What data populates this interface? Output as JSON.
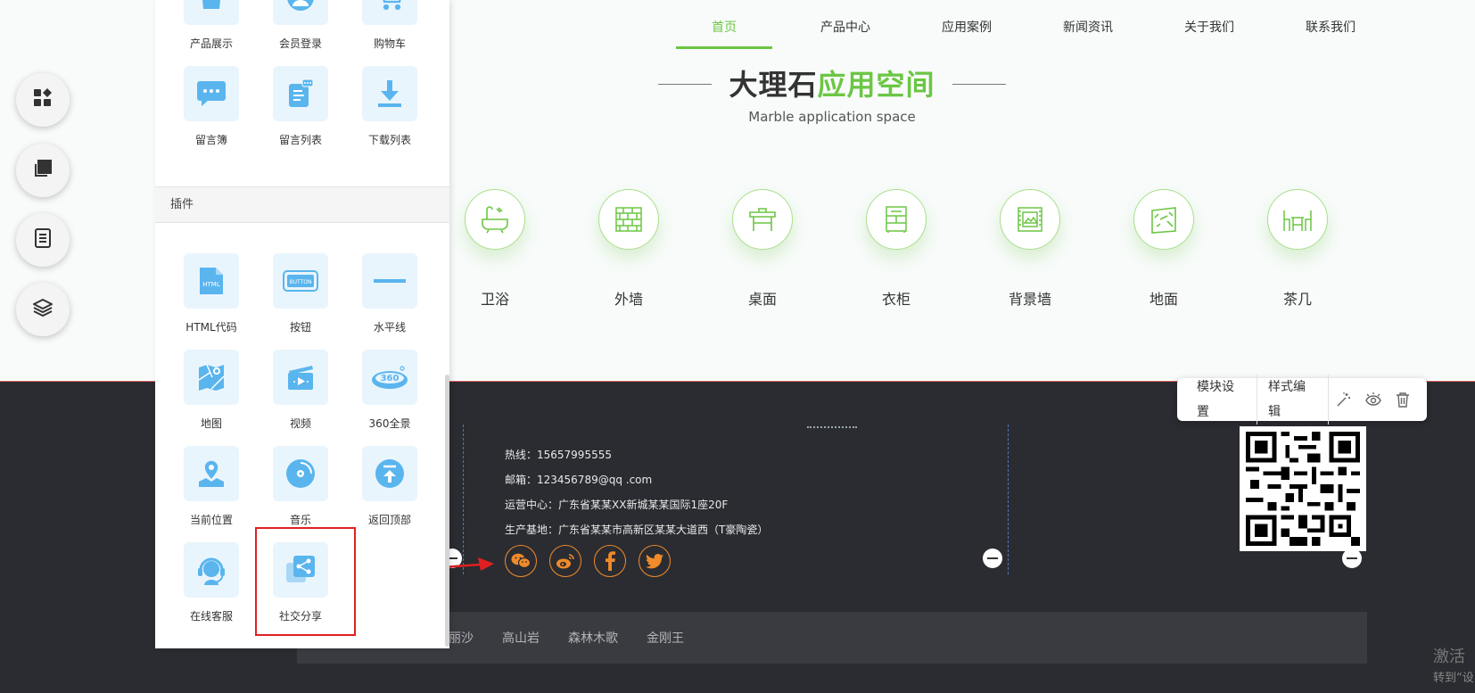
{
  "nav": [
    "首页",
    "产品中心",
    "应用案例",
    "新闻资讯",
    "关于我们",
    "联系我们"
  ],
  "section": {
    "title_dark": "大理石",
    "title_green": "应用空间",
    "subtitle": "Marble application space"
  },
  "categories": [
    "卫浴",
    "外墙",
    "桌面",
    "衣柜",
    "背景墙",
    "地面",
    "茶几"
  ],
  "panel": {
    "top_items": [
      "产品展示",
      "会员登录",
      "购物车",
      "留言簿",
      "留言列表",
      "下载列表"
    ],
    "plugin_header": "插件",
    "plugin_items": [
      "HTML代码",
      "按钮",
      "水平线",
      "地图",
      "视频",
      "360全景",
      "当前位置",
      "音乐",
      "返回顶部",
      "在线客服",
      "社交分享"
    ]
  },
  "footer": {
    "hotline": "热线：15657995555",
    "email": "邮箱：123456789@qq .com",
    "ops_center": "运营中心：广东省某某XX新城某某国际1座20F",
    "base": "生产基地：广东省某某市高新区某某大道西（T豪陶瓷）",
    "links": [
      "丽沙",
      "高山岩",
      "森林木歌",
      "金刚王"
    ]
  },
  "module_bar": {
    "settings": "模块设置",
    "style_edit": "样式编辑"
  },
  "watermark": {
    "line1": "激活",
    "line2": "转到“设"
  },
  "colors": {
    "accent_green": "#6cc644",
    "social_orange": "#f08a2a",
    "footer_bg": "#2b2c31",
    "panel_icon_bg": "#e9f5fd",
    "panel_icon": "#5ab5ee",
    "highlight_red": "#e02020"
  }
}
